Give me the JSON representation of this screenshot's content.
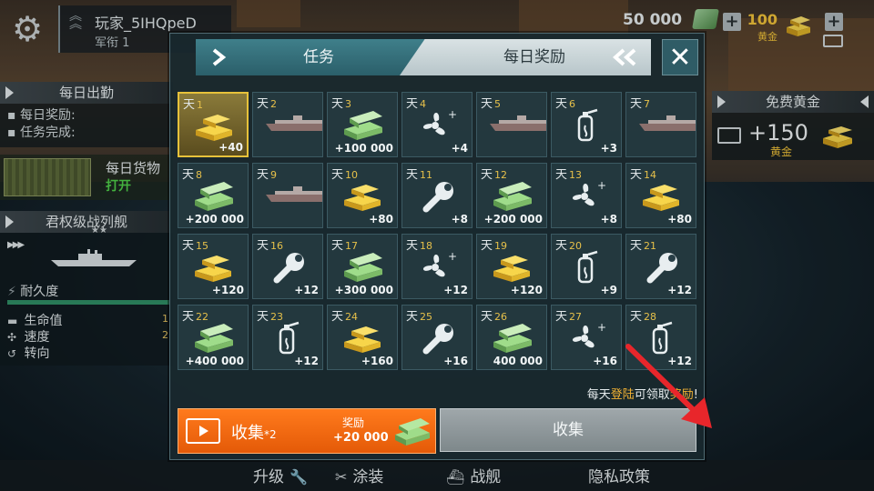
{
  "player": {
    "name": "玩家_5IHQpeD",
    "rank": "军衔 1"
  },
  "currency": {
    "silver": "50 000",
    "gold": "100",
    "gold_label": "黄金"
  },
  "left_panel": {
    "daily_checkin": {
      "title": "每日出勤",
      "lines": [
        "每日奖励:",
        "任务完成:"
      ]
    },
    "cargo": {
      "title": "每日货物",
      "action": "打开"
    },
    "ship": {
      "title": "君权级战列舰",
      "stars": "★★",
      "durability_label": "耐久度",
      "stats": [
        {
          "label": "生命值",
          "value": "1"
        },
        {
          "label": "速度",
          "value": "2"
        },
        {
          "label": "转向",
          "value": ""
        }
      ]
    }
  },
  "right_panel": {
    "title": "免费黄金",
    "amount": "+150",
    "unit": "黄金"
  },
  "bottom_bar": {
    "upgrade": "升级",
    "paint": "涂装",
    "warship": "战舰",
    "privacy": "隐私政策"
  },
  "modal": {
    "tabs": {
      "tasks": "任务",
      "daily": "每日奖励"
    },
    "day_label": "天",
    "rewards": [
      {
        "day": "1",
        "icon": "gold",
        "qty": "+40",
        "claimed": true
      },
      {
        "day": "2",
        "icon": "ship",
        "qty": "",
        "claimed": false
      },
      {
        "day": "3",
        "icon": "cash",
        "qty": "+100 000",
        "claimed": false
      },
      {
        "day": "4",
        "icon": "propeller",
        "qty": "+4",
        "claimed": false
      },
      {
        "day": "5",
        "icon": "ship",
        "qty": "",
        "claimed": false
      },
      {
        "day": "6",
        "icon": "extinguisher",
        "qty": "+3",
        "claimed": false
      },
      {
        "day": "7",
        "icon": "ship",
        "qty": "",
        "claimed": false
      },
      {
        "day": "8",
        "icon": "cash",
        "qty": "+200 000",
        "claimed": false
      },
      {
        "day": "9",
        "icon": "ship",
        "qty": "",
        "claimed": false
      },
      {
        "day": "10",
        "icon": "gold",
        "qty": "+80",
        "claimed": false
      },
      {
        "day": "11",
        "icon": "wrench",
        "qty": "+8",
        "claimed": false
      },
      {
        "day": "12",
        "icon": "cash",
        "qty": "+200 000",
        "claimed": false
      },
      {
        "day": "13",
        "icon": "propeller",
        "qty": "+8",
        "claimed": false
      },
      {
        "day": "14",
        "icon": "gold",
        "qty": "+80",
        "claimed": false
      },
      {
        "day": "15",
        "icon": "gold",
        "qty": "+120",
        "claimed": false
      },
      {
        "day": "16",
        "icon": "wrench",
        "qty": "+12",
        "claimed": false
      },
      {
        "day": "17",
        "icon": "cash",
        "qty": "+300 000",
        "claimed": false
      },
      {
        "day": "18",
        "icon": "propeller",
        "qty": "+12",
        "claimed": false
      },
      {
        "day": "19",
        "icon": "gold",
        "qty": "+120",
        "claimed": false
      },
      {
        "day": "20",
        "icon": "extinguisher",
        "qty": "+9",
        "claimed": false
      },
      {
        "day": "21",
        "icon": "wrench",
        "qty": "+12",
        "claimed": false
      },
      {
        "day": "22",
        "icon": "cash",
        "qty": "+400 000",
        "claimed": false
      },
      {
        "day": "23",
        "icon": "extinguisher",
        "qty": "+12",
        "claimed": false
      },
      {
        "day": "24",
        "icon": "gold",
        "qty": "+160",
        "claimed": false
      },
      {
        "day": "25",
        "icon": "wrench",
        "qty": "+16",
        "claimed": false
      },
      {
        "day": "26",
        "icon": "cash",
        "qty": "400 000",
        "claimed": false
      },
      {
        "day": "27",
        "icon": "propeller",
        "qty": "+16",
        "claimed": false
      },
      {
        "day": "28",
        "icon": "extinguisher",
        "qty": "+12",
        "claimed": false
      }
    ],
    "hint": {
      "pre": "每天",
      "login": "登陆",
      "mid": "可领取",
      "reward": "奖励",
      "post": "!"
    },
    "collect_x2": {
      "label": "收集",
      "mult": "*2",
      "reward_label": "奖励",
      "reward_amount": "+20 000"
    },
    "collect": {
      "label": "收集"
    }
  },
  "colors": {
    "accent_orange": "#ff7a1c",
    "gold": "#f2c43a",
    "teal_tab": "#3f7f8a",
    "hint_highlight": "#f2b233"
  }
}
